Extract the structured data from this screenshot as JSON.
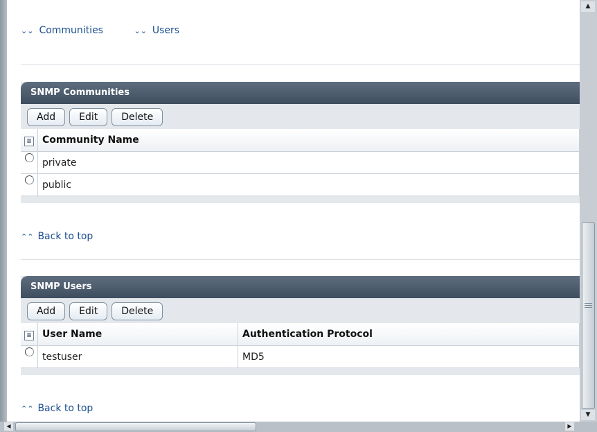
{
  "jump_links": [
    "Communities",
    "Users"
  ],
  "communities_panel": {
    "title": "SNMP Communities",
    "buttons": [
      "Add",
      "Edit",
      "Delete"
    ],
    "columns": [
      "Community Name"
    ],
    "rows": [
      [
        "private"
      ],
      [
        "public"
      ]
    ]
  },
  "users_panel": {
    "title": "SNMP Users",
    "buttons": [
      "Add",
      "Edit",
      "Delete"
    ],
    "columns": [
      "User Name",
      "Authentication Protocol"
    ],
    "rows": [
      [
        "testuser",
        "MD5"
      ]
    ]
  },
  "back_to_top": "Back to top",
  "icons": {
    "jump_chevron": "double-chevron-down-icon",
    "back_chevron": "double-chevron-up-icon",
    "select_all": "select-all-icon"
  },
  "colors": {
    "link": "#1b4f8f",
    "panel_header": "#4a5b6c",
    "panel_body": "#e4e8ec"
  }
}
